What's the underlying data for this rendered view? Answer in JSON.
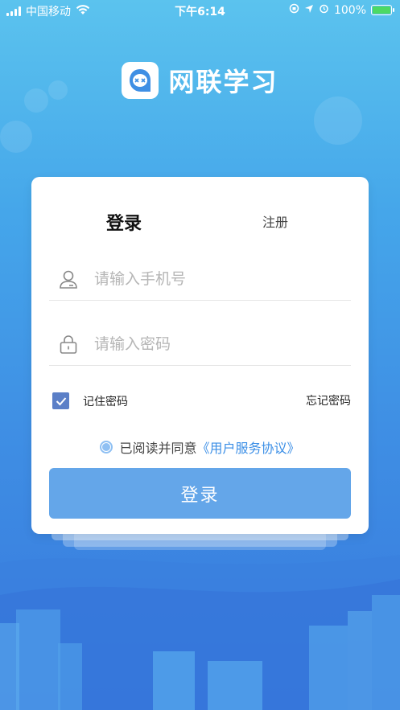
{
  "status_bar": {
    "carrier": "中国移动",
    "time": "下午6:14",
    "battery": "100%"
  },
  "brand": {
    "title": "网联学习"
  },
  "tabs": {
    "login": "登录",
    "register": "注册"
  },
  "form": {
    "phone_placeholder": "请输入手机号",
    "password_placeholder": "请输入密码",
    "remember_label": "记住密码",
    "forgot_label": "忘记密码",
    "agree_text": "已阅读并同意",
    "agree_link": "《用户服务协议》",
    "submit_label": "登录"
  },
  "colors": {
    "accent": "#64a6e9",
    "link": "#3a8ee6",
    "checkbox": "#5b7fc7"
  }
}
